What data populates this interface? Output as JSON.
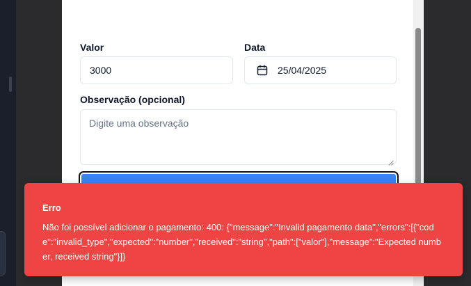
{
  "form": {
    "valor": {
      "label": "Valor",
      "value": "3000"
    },
    "data": {
      "label": "Data",
      "value": "25/04/2025",
      "icon": "calendar-icon"
    },
    "observacao": {
      "label": "Observação (opcional)",
      "placeholder": "Digite uma observação"
    },
    "submit_label": ""
  },
  "toast": {
    "title": "Erro",
    "message": "Não foi possível adicionar o pagamento: 400: {\"message\":\"Invalid pagamento data\",\"errors\":[{\"code\":\"invalid_type\",\"expected\":\"number\",\"received\":\"string\",\"path\":[\"valor\"],\"message\":\"Expected number, received string\"}]}",
    "color": "#ef4444"
  },
  "colors": {
    "accent": "#3b82f6",
    "error": "#ef4444",
    "backdrop": "#2b2b2d"
  }
}
